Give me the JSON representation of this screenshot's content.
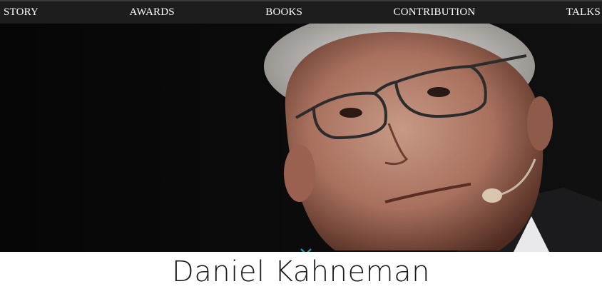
{
  "nav": {
    "items": [
      {
        "label": "STORY"
      },
      {
        "label": "AWARDS"
      },
      {
        "label": "BOOKS"
      },
      {
        "label": "CONTRIBUTION"
      },
      {
        "label": "TALKS"
      }
    ]
  },
  "hero": {
    "scroll_icon": "double-chevron-down-icon",
    "accent_color": "#2a8fa8",
    "background_color": "#050505"
  },
  "profile": {
    "name": "Daniel Kahneman"
  }
}
